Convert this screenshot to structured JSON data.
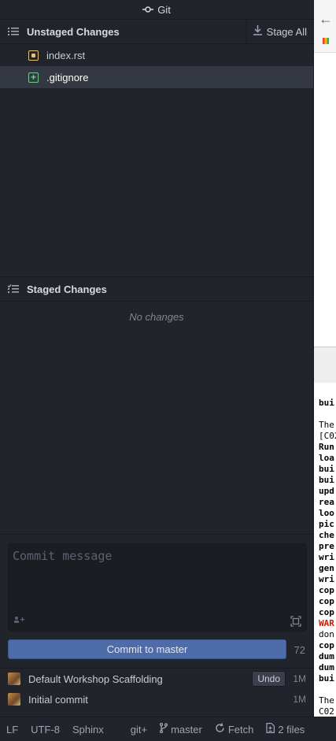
{
  "panel": {
    "title": "Git"
  },
  "unstaged": {
    "title": "Unstaged Changes",
    "stage_all_label": "Stage All",
    "files": [
      {
        "name": "index.rst",
        "status": "modified"
      },
      {
        "name": ".gitignore",
        "status": "added"
      }
    ]
  },
  "staged": {
    "title": "Staged Changes",
    "empty_text": "No changes"
  },
  "commit": {
    "placeholder": "Commit message",
    "button_label": "Commit to master",
    "remaining_chars": "72"
  },
  "recent_commits": [
    {
      "message": "Default Workshop Scaffolding",
      "undo_label": "Undo",
      "time": "1M"
    },
    {
      "message": "Initial commit",
      "time": "1M"
    }
  ],
  "status_bar": {
    "line_ending": "LF",
    "encoding": "UTF-8",
    "grammar": "Sphinx",
    "git_plus": "git+",
    "branch": "master",
    "fetch": "Fetch",
    "files_changed": "2 files"
  },
  "terminal_lines": [
    "bui",
    "",
    "The",
    "[C02",
    "Run",
    "loa",
    "bui",
    "bui",
    "upd",
    "rea",
    "loo",
    "pic",
    "che",
    "pre",
    "wri",
    "gen",
    "wri",
    "cop",
    "cop",
    "cop",
    "WAR",
    "don",
    "cop",
    "dum",
    "dum",
    "bui",
    "",
    "The",
    "C02"
  ],
  "colors": {
    "panel_bg": "#21252b",
    "selected_bg": "#333842",
    "modified": "#e5c07b",
    "added": "#73c990",
    "commit_button": "#4d6ca8"
  }
}
